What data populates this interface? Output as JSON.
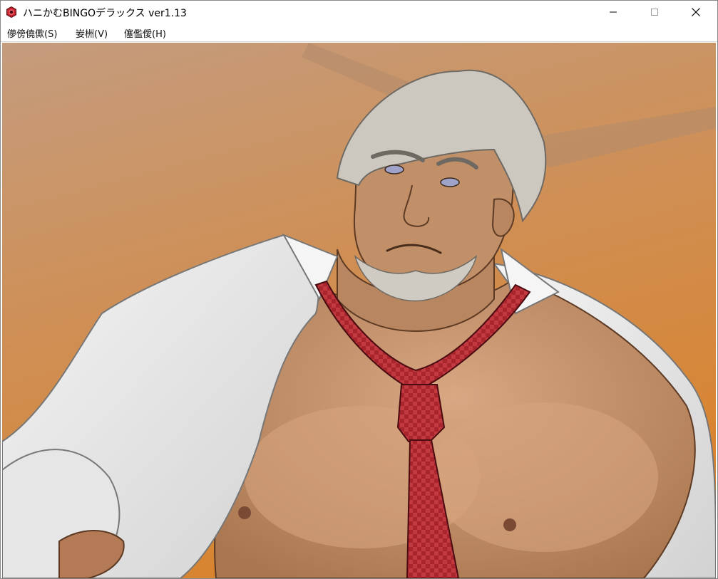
{
  "window": {
    "title": "ハニかむBINGOデラックス ver1.13",
    "icon": "red-hexagon-app-icon",
    "controls": {
      "minimize": "minimize-icon",
      "maximize": "maximize-icon",
      "close": "close-icon"
    }
  },
  "menu": {
    "items": [
      {
        "label": "儚傍僥僛(S)"
      },
      {
        "label": "妛栦(V)"
      },
      {
        "label": "僿儖僾(H)"
      }
    ]
  },
  "scene": {
    "description_icon": "game-cg-character",
    "colors": {
      "background_top": "#c79a78",
      "background_bottom": "#d98a3e",
      "shirt": "#ececec",
      "skin": "#c99670",
      "tie": "#a3242c",
      "hair": "#cbc6bd"
    }
  }
}
